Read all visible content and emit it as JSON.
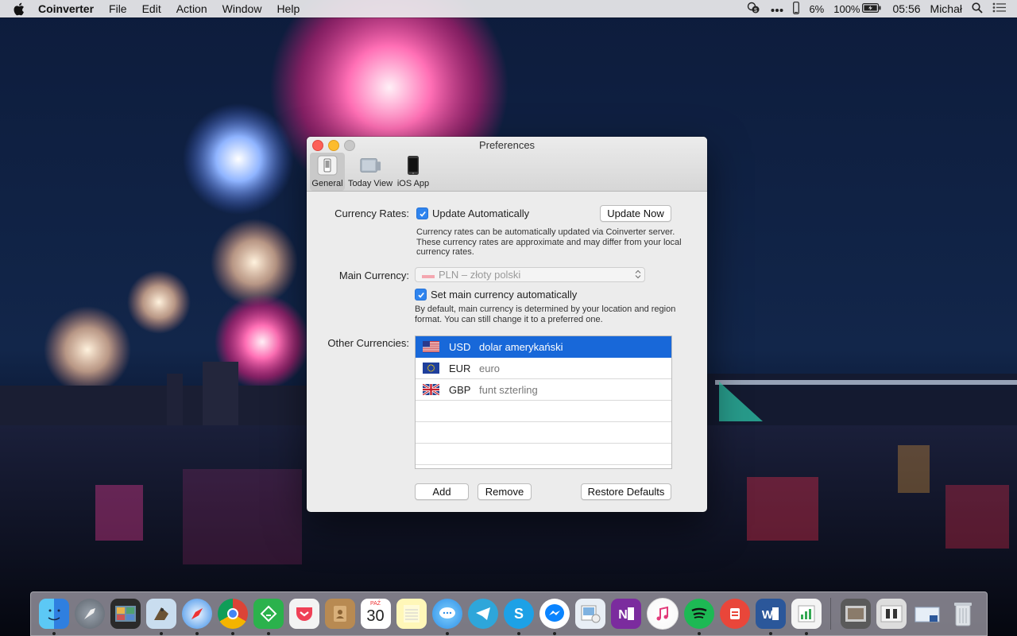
{
  "menubar": {
    "app_name": "Coinverter",
    "menus": [
      "File",
      "Edit",
      "Action",
      "Window",
      "Help"
    ],
    "battery_secondary": "6%",
    "battery": "100%",
    "clock": "05:56",
    "user": "Michał"
  },
  "window": {
    "title": "Preferences",
    "tabs": [
      {
        "label": "General",
        "icon": "general-icon",
        "active": true
      },
      {
        "label": "Today View",
        "icon": "today-view-icon",
        "active": false
      },
      {
        "label": "iOS App",
        "icon": "iphone-icon",
        "active": false
      }
    ],
    "currency_rates_label": "Currency Rates:",
    "update_automatically": "Update Automatically",
    "update_automatically_checked": true,
    "update_now_button": "Update Now",
    "update_note": [
      "Currency rates can be automatically updated via Coinverter server.",
      "These currency rates are approximate and may differ from your local",
      "currency rates."
    ],
    "main_currency_label": "Main Currency:",
    "main_currency_value": "PLN – złoty polski",
    "set_main_auto": "Set main currency automatically",
    "set_main_auto_checked": true,
    "main_note": [
      "By default, main currency is determined by your location and region",
      "format. You can still change it to a preferred one."
    ],
    "other_currencies_label": "Other Currencies:",
    "other_currencies": [
      {
        "code": "USD",
        "name": "dolar amerykański",
        "flag": "us-flag",
        "selected": true
      },
      {
        "code": "EUR",
        "name": "euro",
        "flag": "eu-flag",
        "selected": false
      },
      {
        "code": "GBP",
        "name": "funt szterling",
        "flag": "uk-flag",
        "selected": false
      }
    ],
    "add_button": "Add",
    "remove_button": "Remove",
    "restore_button": "Restore Defaults"
  },
  "calendar": {
    "month": "PAŹ",
    "day": "30"
  },
  "dock": {
    "icons": [
      "finder-icon",
      "launchpad-icon",
      "image-capture-icon",
      "preview-bird-icon",
      "safari-icon",
      "chrome-icon",
      "feedly-icon",
      "pocket-icon",
      "contacts-icon",
      "calendar-icon",
      "notes-icon",
      "messages-icon",
      "telegram-icon",
      "skype-icon",
      "messenger-icon",
      "preview-icon",
      "onenote-icon",
      "itunes-icon",
      "spotify-icon",
      "coinverter-icon",
      "word-icon",
      "numbers-icon",
      "folder-stack-icon",
      "folder-stack-2-icon",
      "downloads-icon",
      "trash-icon"
    ]
  }
}
